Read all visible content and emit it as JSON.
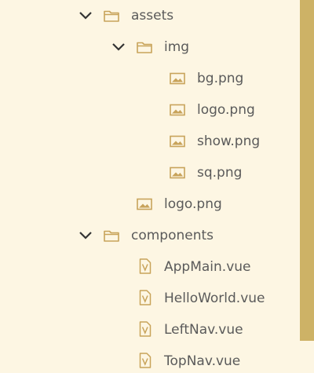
{
  "explorer": {
    "items": [
      {
        "type": "folder",
        "expanded": true,
        "label": "assets"
      },
      {
        "type": "folder",
        "expanded": true,
        "label": "img"
      },
      {
        "type": "image",
        "label": "bg.png"
      },
      {
        "type": "image",
        "label": "logo.png"
      },
      {
        "type": "image",
        "label": "show.png"
      },
      {
        "type": "image",
        "label": "sq.png"
      },
      {
        "type": "image",
        "label": "logo.png"
      },
      {
        "type": "folder",
        "expanded": true,
        "label": "components"
      },
      {
        "type": "vue",
        "label": "AppMain.vue"
      },
      {
        "type": "vue",
        "label": "HelloWorld.vue"
      },
      {
        "type": "vue",
        "label": "LeftNav.vue"
      },
      {
        "type": "vue",
        "label": "TopNav.vue"
      }
    ]
  },
  "colors": {
    "background": "#fdf6e3",
    "icon": "#c8a35a",
    "chevron": "#333333",
    "scrollbar_thumb": "#cdb266"
  },
  "icons": {
    "chevron": "chevron-down-icon",
    "folder": "folder-icon",
    "image": "image-file-icon",
    "vue": "vue-file-icon"
  }
}
